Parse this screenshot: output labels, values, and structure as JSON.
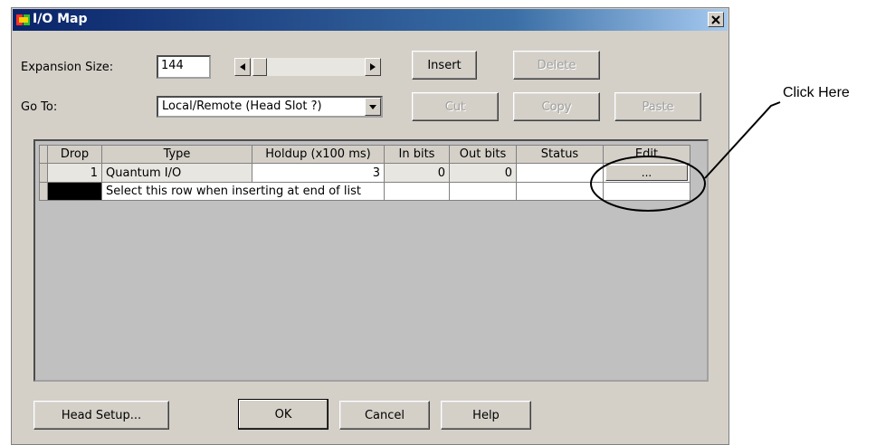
{
  "window": {
    "title": "I/O Map"
  },
  "expansion": {
    "label": "Expansion Size:",
    "value": "144"
  },
  "goto": {
    "label": "Go To:",
    "selected": "Local/Remote (Head Slot ?)"
  },
  "buttons": {
    "insert": "Insert",
    "delete": "Delete",
    "cut": "Cut",
    "copy": "Copy",
    "paste": "Paste",
    "head_setup": "Head Setup...",
    "ok": "OK",
    "cancel": "Cancel",
    "help": "Help"
  },
  "grid": {
    "columns": [
      "Drop",
      "Type",
      "Holdup (x100 ms)",
      "In bits",
      "Out bits",
      "Status",
      "Edit"
    ],
    "rows": [
      {
        "drop": "1",
        "type": "Quantum I/O",
        "holdup": "3",
        "in_bits": "0",
        "out_bits": "0",
        "status": "",
        "edit": "..."
      }
    ],
    "end_row_text": "Select this row when inserting at end of list"
  },
  "annotation": {
    "text": "Click Here"
  },
  "colors": {
    "titlebar": "#0a246a",
    "dialog": "#d4d0c8"
  }
}
